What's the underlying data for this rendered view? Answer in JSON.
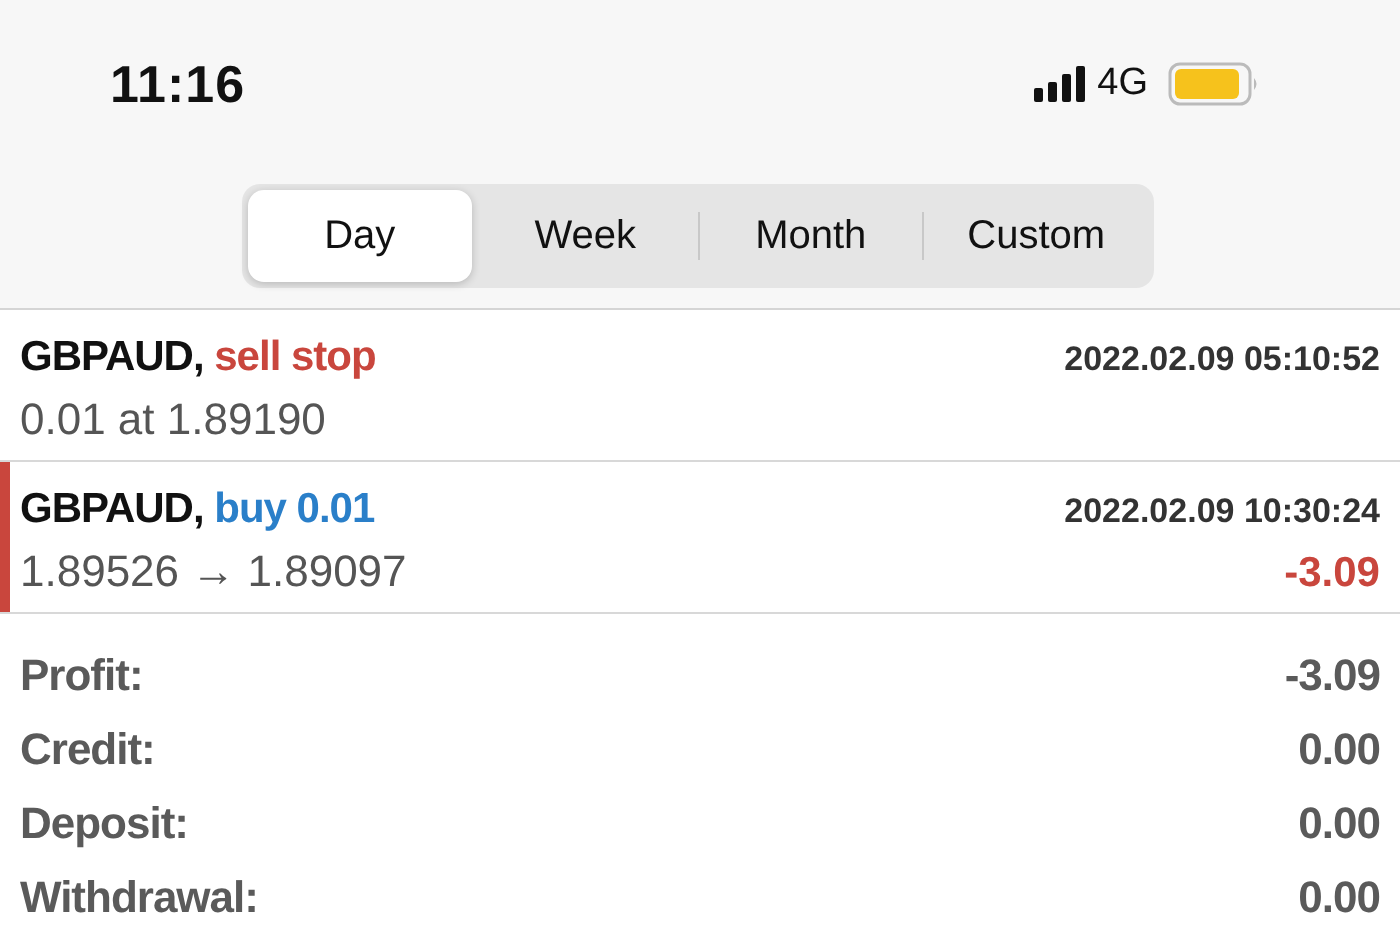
{
  "status_bar": {
    "time": "11:16",
    "network": "4G"
  },
  "tabs": [
    {
      "label": "Day",
      "selected": true
    },
    {
      "label": "Week",
      "selected": false
    },
    {
      "label": "Month",
      "selected": false
    },
    {
      "label": "Custom",
      "selected": false
    }
  ],
  "orders": [
    {
      "symbol": "GBPAUD,",
      "action": "sell stop",
      "color": "#c9463d",
      "time": "2022.02.09 05:10:52",
      "detail": "0.01 at 1.89190",
      "highlighted": false
    },
    {
      "symbol": "GBPAUD,",
      "action": "buy 0.01",
      "color": "#2a7fc9",
      "time": "2022.02.09 10:30:24",
      "detail": "1.89526 → 1.89097",
      "profit": "-3.09",
      "highlighted": true
    }
  ],
  "summary": [
    {
      "label": "Profit:",
      "value": "-3.09"
    },
    {
      "label": "Credit:",
      "value": "0.00"
    },
    {
      "label": "Deposit:",
      "value": "0.00"
    },
    {
      "label": "Withdrawal:",
      "value": "0.00"
    }
  ]
}
